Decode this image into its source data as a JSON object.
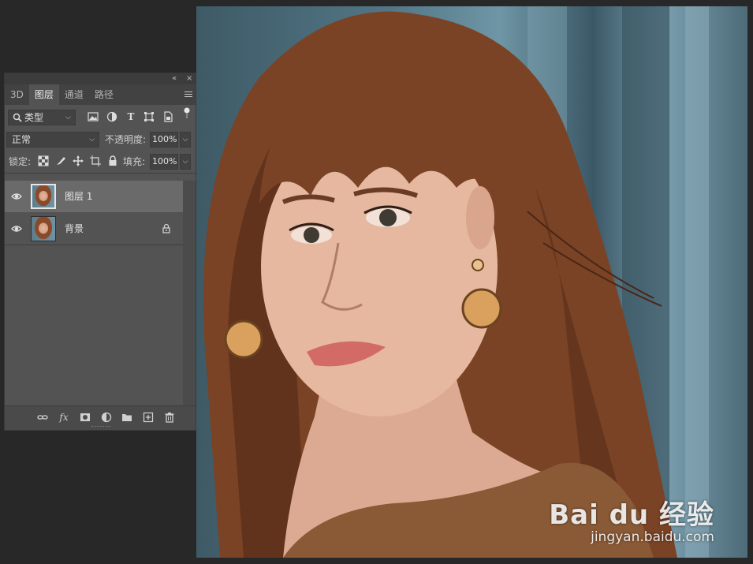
{
  "panel": {
    "controls": {
      "collapse": "«",
      "close": "×"
    },
    "tabs": [
      {
        "label": "3D",
        "active": false
      },
      {
        "label": "图层",
        "active": true
      },
      {
        "label": "通道",
        "active": false
      },
      {
        "label": "路径",
        "active": false
      }
    ],
    "filter": {
      "kind_label": "类型",
      "icons": [
        "image-filter-icon",
        "adjustment-filter-icon",
        "type-filter-icon",
        "shape-filter-icon",
        "smart-object-filter-icon",
        "filter-toggle-icon"
      ],
      "type_glyph": "T"
    },
    "blend": {
      "mode": "正常",
      "opacity_label": "不透明度:",
      "opacity_value": "100%"
    },
    "lock": {
      "label": "锁定:",
      "icons": [
        "lock-transparent-icon",
        "lock-paint-icon",
        "lock-position-icon",
        "lock-artboard-icon",
        "lock-all-icon"
      ],
      "fill_label": "填充:",
      "fill_value": "100%"
    },
    "layers": [
      {
        "name": "图层 1",
        "selected": true,
        "visible": true,
        "locked": false
      },
      {
        "name": "背景",
        "selected": false,
        "visible": true,
        "locked": true
      }
    ],
    "bottom_icons": [
      "link-layers-icon",
      "fx-icon",
      "layer-mask-icon",
      "adjustment-layer-icon",
      "group-folder-icon",
      "new-layer-icon",
      "delete-trash-icon"
    ],
    "fx_glyph": "fx"
  },
  "canvas": {
    "watermark_logo": "Bai du 经验",
    "watermark_url": "jingyan.baidu.com"
  },
  "colors": {
    "app_background": "#282828",
    "panel_background": "#535353",
    "tab_strip": "#424242",
    "selected_layer": "#6a6a6a",
    "hair": "#7a4326",
    "skin": "#e6b8a0",
    "lips": "#d26a66",
    "backdrop": "#5b7f8e",
    "sweater": "#8a5a36"
  }
}
